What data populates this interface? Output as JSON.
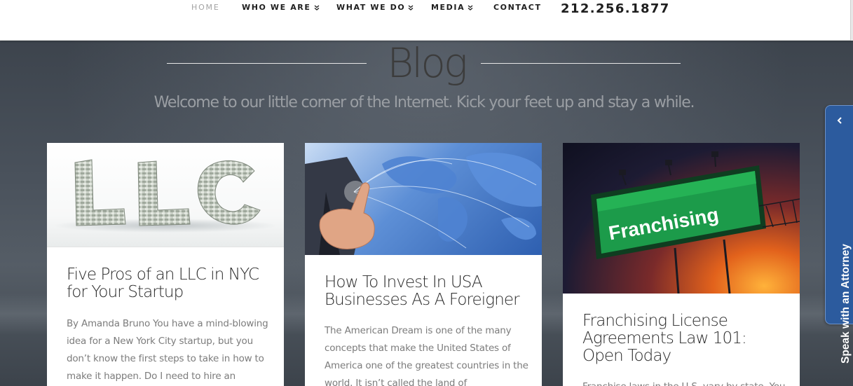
{
  "nav": {
    "items": [
      {
        "label": "HOME",
        "active": true
      },
      {
        "label": "WHO WE ARE",
        "dropdown": true
      },
      {
        "label": "WHAT WE DO",
        "dropdown": true
      },
      {
        "label": "MEDIA",
        "dropdown": true
      },
      {
        "label": "CONTACT"
      }
    ],
    "phone": "212.256.1877"
  },
  "hero": {
    "title": "Blog",
    "tagline": "Welcome to our little corner of the Internet. Kick your feet up and stay a while."
  },
  "posts": [
    {
      "image_icon": "llc-letters-image",
      "image_text": "LLC",
      "title": "Five Pros of an LLC in NYC for Your Startup",
      "excerpt": "By Amanda Bruno You have a mind-blowing idea for a New York City startup, but you don’t know the first steps to take in how to make it happen. Do I need to hire an"
    },
    {
      "image_icon": "businessman-world-map-image",
      "title": "How To Invest In USA Businesses As A Foreigner",
      "excerpt": "The American Dream is one of the many concepts that make the United States of America one of the greatest countries in the world. It isn’t called the land of"
    },
    {
      "image_icon": "franchising-billboard-image",
      "image_text": "Franchising",
      "title": "Franchising License Agreements Law 101: Open Today",
      "excerpt": "Franchise laws in the U.S. vary by state. You"
    }
  ],
  "side_tab": {
    "label": "Speak with an Attorney",
    "color": "#2c5b9e"
  }
}
